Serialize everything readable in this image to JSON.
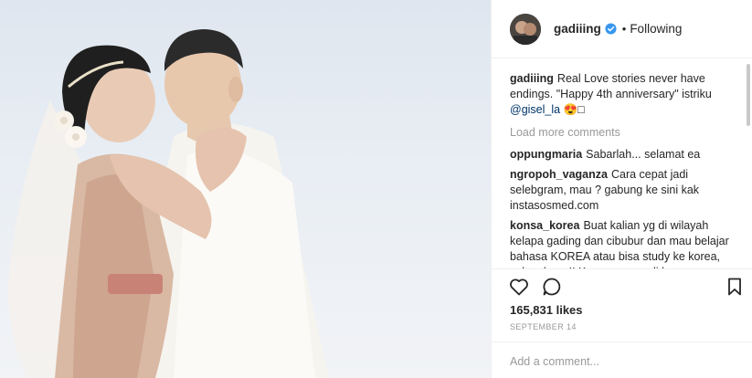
{
  "post": {
    "username": "gadiiing",
    "verified": true,
    "follow_status": "Following",
    "separator": "•",
    "caption": {
      "user": "gadiiing",
      "text": "Real Love stories never have endings. \"Happy 4th anniversary\" istriku",
      "mention": "@gisel_la",
      "emoji": "😍□"
    },
    "load_more": "Load more comments",
    "comments": [
      {
        "user": "oppungmaria",
        "text": "Sabarlah... selamat ea"
      },
      {
        "user": "ngropoh_vaganza",
        "text": "Cara cepat jadi selebgram, mau ? gabung ke sini kak instasosmed.com"
      },
      {
        "user": "konsa_korea",
        "text": "Buat kalian yg di wilayah kelapa gading dan cibubur dan mau belajar bahasa KOREA atau bisa study ke korea, yuk gabung!! Karena cuma di konsa"
      }
    ],
    "likes": "165,831 likes",
    "date": "September 14",
    "add_comment_placeholder": "Add a comment...",
    "icons": [
      "heart-icon",
      "comment-icon",
      "bookmark-icon",
      "verified-badge-icon"
    ],
    "colors": {
      "verified": "#3897f0",
      "mention": "#003569",
      "muted": "#999999"
    }
  }
}
